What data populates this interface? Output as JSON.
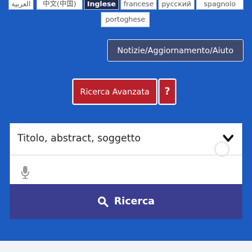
{
  "languages": {
    "tabs": [
      {
        "label": "العربية"
      },
      {
        "label": "中文(中国)"
      },
      {
        "label": "Inglese",
        "active": true
      },
      {
        "label": "francese"
      },
      {
        "label": "русский"
      },
      {
        "label": "spagnolo"
      }
    ],
    "second_row": {
      "label": "portoghese"
    }
  },
  "news_button": {
    "label": "Notizie/Aggiornamento/Aiuto"
  },
  "advanced_search": {
    "label": "Ricerca Avanzata",
    "help_label": "?"
  },
  "search": {
    "field_select_label": "Titolo, abstract, soggetto",
    "submit_label": "Ricerca",
    "icons": [
      "chevron-down-icon",
      "microphone-icon",
      "search-icon"
    ]
  },
  "colors": {
    "background": "#1c5bbf",
    "accent_red": "#b8202b",
    "search_button": "#3b3d8f",
    "active_lang": "#1f2a4e"
  }
}
